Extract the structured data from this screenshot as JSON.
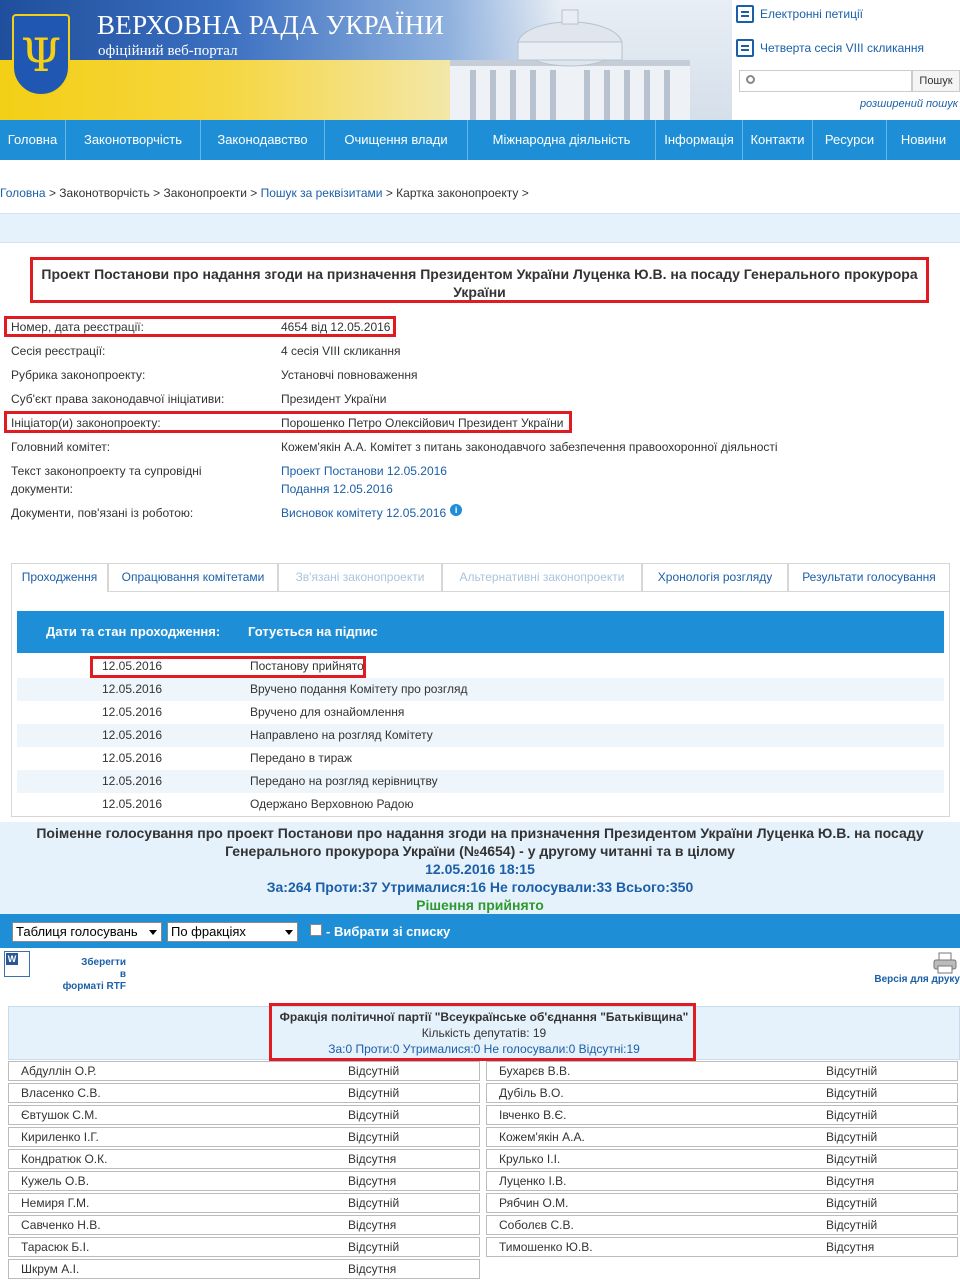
{
  "header": {
    "site_title": "ВЕРХОВНА РАДА УКРАЇНИ",
    "site_subtitle": "офіційний веб-портал",
    "emblem_glyph": "Ψ",
    "top_links": [
      "Електронні петиції",
      "Четверта сесія VIII скликання"
    ],
    "search_button": "Пошук",
    "search_placeholder": "",
    "advanced_search": "розширений пошук"
  },
  "nav": [
    "Головна",
    "Законотворчість",
    "Законодавство",
    "Очищення влади",
    "Міжнародна діяльність",
    "Інформація",
    "Контакти",
    "Ресурси",
    "Новини"
  ],
  "breadcrumb": {
    "items": [
      "Головна",
      "Законотворчість",
      "Законопроекти",
      "Пошук за реквізитами",
      "Картка законопроекту"
    ],
    "separator": ">"
  },
  "bill": {
    "title": "Проект Постанови про надання згоди на призначення Президентом України Луценка Ю.В. на посаду Генерального прокурора України",
    "fields": [
      {
        "label": "Номер, дата реєстрації:",
        "value": "4654 від 12.05.2016"
      },
      {
        "label": "Сесія реєстрації:",
        "value": "4 сесія VIII скликання"
      },
      {
        "label": "Рубрика законопроекту:",
        "value": "Установчі повноваження"
      },
      {
        "label": "Суб'єкт права законодавчої ініціативи:",
        "value": "Президент України"
      },
      {
        "label": "Ініціатор(и) законопроекту:",
        "value": "Порошенко Петро Олексійович Президент України"
      },
      {
        "label": "Головний комітет:",
        "value": "Кожем'якін А.А. Комітет з питань законодавчого забезпечення правоохоронної діяльності"
      }
    ],
    "docs_label": "Текст законопроекту та супровідні документи:",
    "docs": [
      "Проект Постанови 12.05.2016",
      "Подання 12.05.2016"
    ],
    "related_label": "Документи, пов'язані із роботою:",
    "related": [
      "Висновок комітету 12.05.2016"
    ],
    "info_icon_glyph": "i"
  },
  "tabs": [
    "Проходження",
    "Опрацювання комітетами",
    "Зв'язані законопроекти",
    "Альтернативні законопроекти",
    "Хронологія розгляду",
    "Результати голосування"
  ],
  "stages": {
    "header_label": "Дати та стан проходження:",
    "header_status": "Готується на підпис",
    "rows": [
      {
        "date": "12.05.2016",
        "text": "Постанову прийнято"
      },
      {
        "date": "12.05.2016",
        "text": "Вручено подання Комітету про розгляд"
      },
      {
        "date": "12.05.2016",
        "text": "Вручено для ознайомлення"
      },
      {
        "date": "12.05.2016",
        "text": "Направлено на розгляд Комітету"
      },
      {
        "date": "12.05.2016",
        "text": "Передано в тираж"
      },
      {
        "date": "12.05.2016",
        "text": "Передано на розгляд керівництву"
      },
      {
        "date": "12.05.2016",
        "text": "Одержано Верховною Радою"
      }
    ]
  },
  "voting": {
    "title": "Поіменне голосування про проект Постанови про надання згоди на призначення Президентом України Луценка Ю.В. на посаду Генерального прокурора України (№4654) - у другому читанні та в цілому",
    "datetime": "12.05.2016 18:15",
    "stats": "За:264 Проти:37 Утрималися:16 Не голосували:33 Всього:350",
    "decision": "Рішення прийнято",
    "select_table": "Таблиця голосувань",
    "select_fraction": "По фракціях",
    "choose_label": "- Вибрати зі списку",
    "rtf_lines": [
      "Зберегти",
      "в",
      "форматі RTF"
    ],
    "print_label": "Версія для друку"
  },
  "fraction": {
    "name": "Фракція політичної партії \"Всеукраїнське об'єднання \"Батьківщина\"",
    "count": "Кількість депутатів: 19",
    "votes": "За:0 Проти:0 Утрималися:0 Не голосували:0 Відсутні:19"
  },
  "deputies_left": [
    {
      "name": "Абдуллін О.Р.",
      "vote": "Відсутній"
    },
    {
      "name": "Власенко С.В.",
      "vote": "Відсутній"
    },
    {
      "name": "Євтушок С.М.",
      "vote": "Відсутній"
    },
    {
      "name": "Кириленко І.Г.",
      "vote": "Відсутній"
    },
    {
      "name": "Кондратюк О.К.",
      "vote": "Відсутня"
    },
    {
      "name": "Кужель О.В.",
      "vote": "Відсутня"
    },
    {
      "name": "Немиря Г.М.",
      "vote": "Відсутній"
    },
    {
      "name": "Савченко Н.В.",
      "vote": "Відсутня"
    },
    {
      "name": "Тарасюк Б.І.",
      "vote": "Відсутній"
    },
    {
      "name": "Шкрум А.І.",
      "vote": "Відсутня"
    }
  ],
  "deputies_right": [
    {
      "name": "Бухарєв В.В.",
      "vote": "Відсутній"
    },
    {
      "name": "Дубіль В.О.",
      "vote": "Відсутній"
    },
    {
      "name": "Івченко В.Є.",
      "vote": "Відсутній"
    },
    {
      "name": "Кожем'якін А.А.",
      "vote": "Відсутній"
    },
    {
      "name": "Крулько І.І.",
      "vote": "Відсутній"
    },
    {
      "name": "Луценко І.В.",
      "vote": "Відсутня"
    },
    {
      "name": "Рябчин О.М.",
      "vote": "Відсутній"
    },
    {
      "name": "Соболєв С.В.",
      "vote": "Відсутній"
    },
    {
      "name": "Тимошенко Ю.В.",
      "vote": "Відсутня"
    }
  ],
  "colors": {
    "accent": "#1e8fd6",
    "highlight": "#e11b22",
    "link": "#1b5fa8",
    "decision": "#2e9a2e"
  }
}
